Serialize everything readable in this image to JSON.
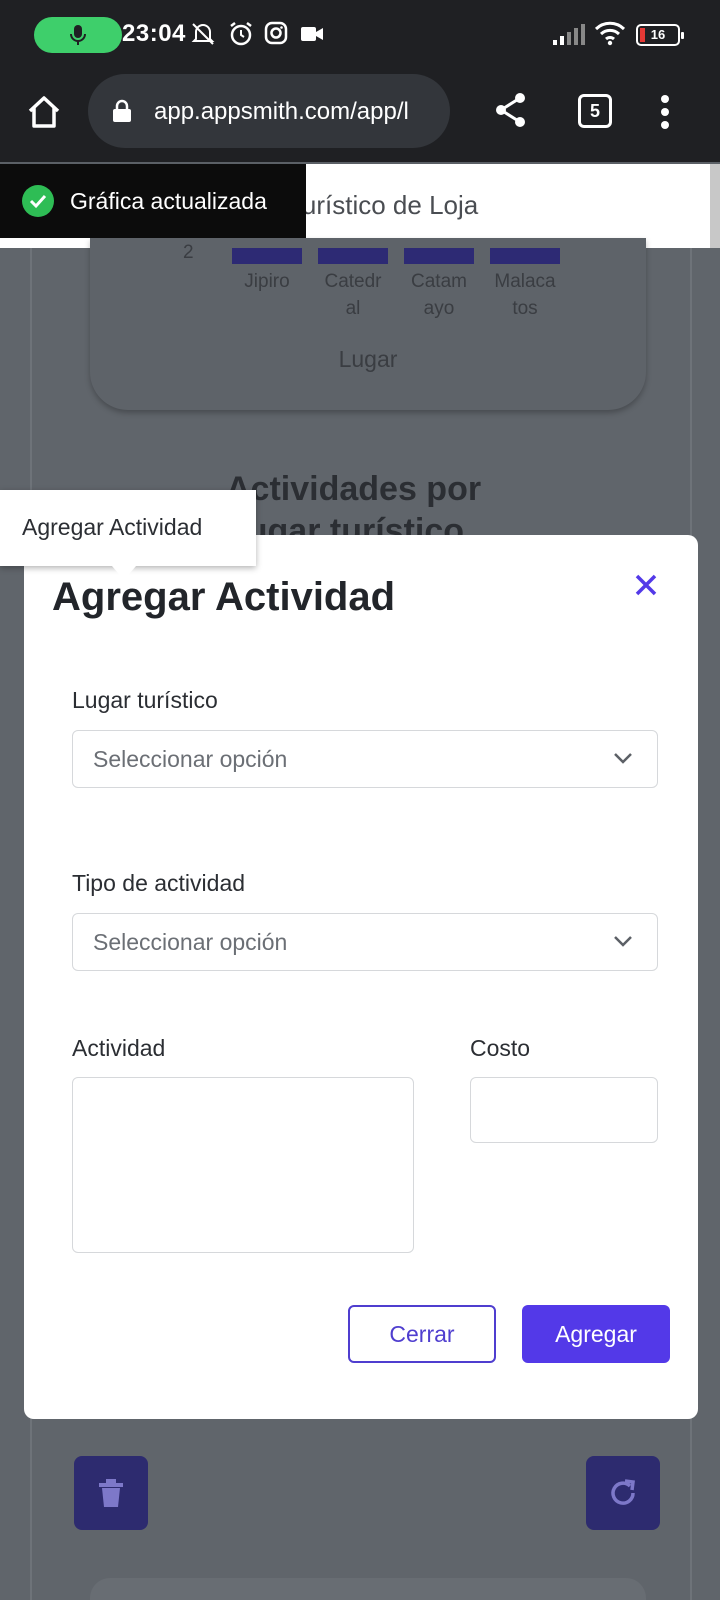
{
  "status_bar": {
    "time": "23:04",
    "battery": "16",
    "icons": [
      "mic-icon",
      "bell-off-icon",
      "alarm-icon",
      "instagram-icon",
      "video-icon",
      "signal-icon",
      "wifi-icon",
      "battery-icon"
    ]
  },
  "browser": {
    "url": "app.appsmith.com/app/l",
    "tab_count": "5"
  },
  "app": {
    "header_title": "es turístico de Loja",
    "chart_data": {
      "type": "bar",
      "categories": [
        "Jipiro",
        "Catedr\nal",
        "Catam\nayo",
        "Malaca\ntos"
      ],
      "xlabel": "Lugar",
      "y_ticks": [
        "2"
      ]
    },
    "section_title": "Actividades por\nLugar turístico"
  },
  "toast": {
    "message": "Gráfica actualizada"
  },
  "tooltip": {
    "text": "Agregar Actividad"
  },
  "modal": {
    "title": "Agregar Actividad",
    "fields": {
      "lugar_label": "Lugar turístico",
      "lugar_placeholder": "Seleccionar opción",
      "tipo_label": "Tipo de actividad",
      "tipo_placeholder": "Seleccionar opción",
      "actividad_label": "Actividad",
      "costo_label": "Costo"
    },
    "buttons": {
      "cerrar": "Cerrar",
      "agregar": "Agregar"
    }
  },
  "colors": {
    "accent": "#5339e8",
    "toast_success": "#2ebd55",
    "dark_bar": "#1f2023"
  }
}
